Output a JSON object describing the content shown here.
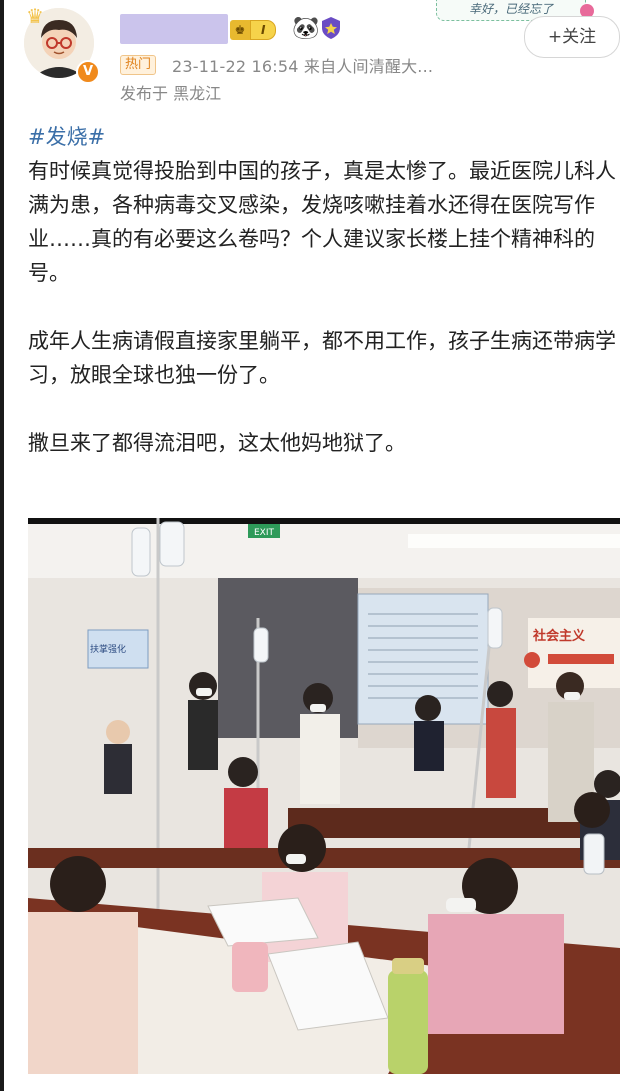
{
  "header": {
    "crown_icon": "crown-icon",
    "verified_badge": "V",
    "rank_level": "I",
    "hot_tag": "热门",
    "meta": "23-11-22 16:54  来自人间清醒大...",
    "location": "发布于 黑龙江",
    "follow_label": "+关注",
    "sticker_text": "幸好，已经忘了"
  },
  "post": {
    "hashtag": "#发烧#",
    "paragraphs": [
      "有时候真觉得投胎到中国的孩子，真是太惨了。最近医院儿科人满为患，各种病毒交叉感染，发烧咳嗽挂着水还得在医院写作业……真的有必要这么卷吗？个人建议家长楼上挂个精神科的号。",
      "成年人生病请假直接家里躺平，都不用工作，孩子生病还带病学习，放眼全球也独一份了。",
      "撒旦来了都得流泪吧，这太他妈地狱了。"
    ]
  },
  "photo": {
    "wall_sign_text": "社会主义",
    "exit_sign": "EXIT",
    "board_sign": "扶掌强化"
  },
  "colors": {
    "hashtag": "#3b6fa8",
    "hot_tag": "#e0821c",
    "meta": "#888888",
    "accent_orange": "#f08a1d"
  }
}
